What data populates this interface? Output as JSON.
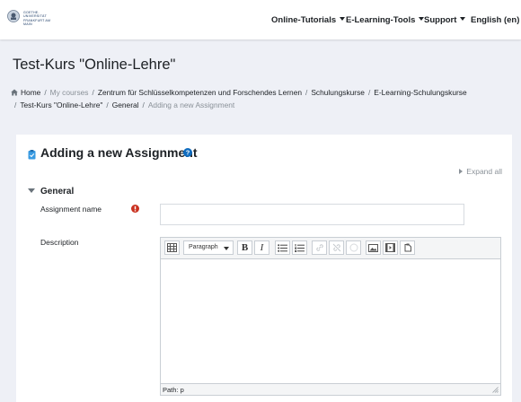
{
  "navbar": {
    "logo_text": "GOETHE-UNIVERSITÄT FRANKFURT AM MAIN",
    "items": [
      {
        "label": "Online-Tutorials"
      },
      {
        "label": "E-Learning-Tools"
      },
      {
        "label": "Support"
      },
      {
        "label": "English (en)"
      }
    ]
  },
  "page": {
    "course_title": "Test-Kurs \"Online-Lehre\""
  },
  "breadcrumb": [
    "Home",
    "My courses",
    "Zentrum für Schlüsselkompetenzen und Forschendes Lernen",
    "Schulungskurse",
    "E-Learning-Schulungskurse",
    "Test-Kurs \"Online-Lehre\"",
    "General",
    "Adding a new Assignment"
  ],
  "form": {
    "title": "Adding a new Assignment",
    "expand_all": "Expand all",
    "section": "General",
    "assignment_name_label": "Assignment name",
    "assignment_name_value": "",
    "description_label": "Description"
  },
  "editor": {
    "paragraph_select": "Paragraph",
    "bold": "B",
    "italic": "I",
    "path": "Path: p",
    "content": ""
  },
  "colors": {
    "accent": "#0f6cbf",
    "required": "#ca3120",
    "background": "#eef0f6"
  }
}
